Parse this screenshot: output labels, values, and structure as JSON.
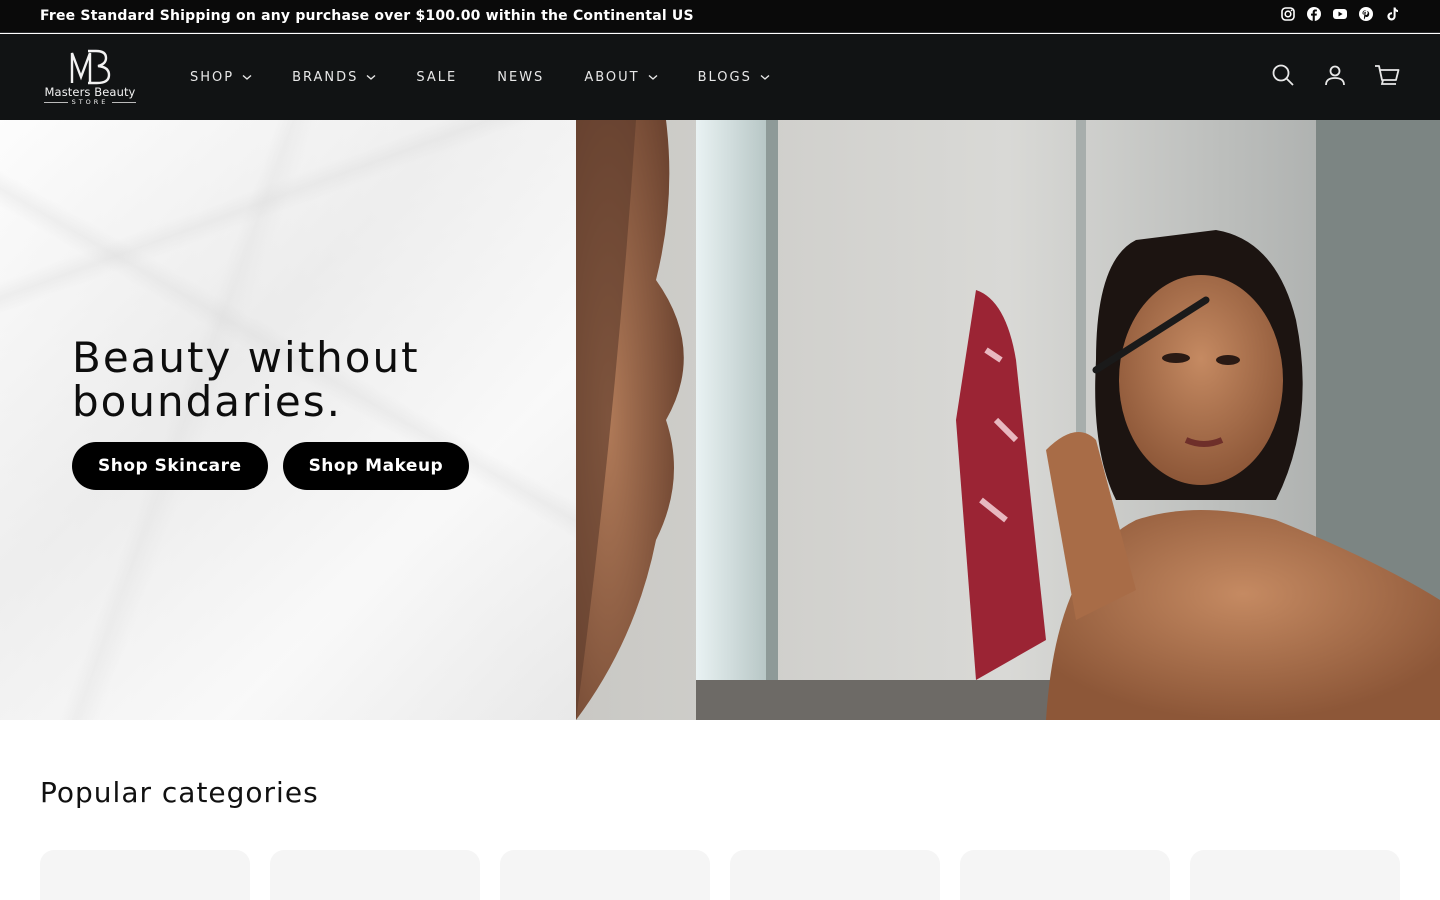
{
  "announcement": {
    "text": "Free Standard Shipping on any purchase over $100.00 within the Continental US",
    "social_icons": [
      "instagram-icon",
      "facebook-icon",
      "youtube-icon",
      "pinterest-icon",
      "tiktok-icon"
    ]
  },
  "header": {
    "logo": {
      "monogram": "MB",
      "wordmark": "Masters Beauty",
      "sub": "STORE"
    },
    "nav": [
      {
        "label": "SHOP",
        "has_dropdown": true
      },
      {
        "label": "BRANDS",
        "has_dropdown": true
      },
      {
        "label": "SALE",
        "has_dropdown": false
      },
      {
        "label": "NEWS",
        "has_dropdown": false
      },
      {
        "label": "ABOUT",
        "has_dropdown": true
      },
      {
        "label": "BLOGS",
        "has_dropdown": true
      }
    ],
    "icons": [
      "search-icon",
      "account-icon",
      "cart-icon"
    ]
  },
  "hero": {
    "title": "Beauty without boundaries.",
    "buttons": [
      "Shop Skincare",
      "Shop Makeup"
    ]
  },
  "categories": {
    "heading": "Popular categories",
    "card_count_visible": 6
  },
  "colors": {
    "announcement_bg": "#0a0a0a",
    "header_bg": "#111314",
    "button_bg": "#000000",
    "card_bg": "#f5f5f5"
  }
}
